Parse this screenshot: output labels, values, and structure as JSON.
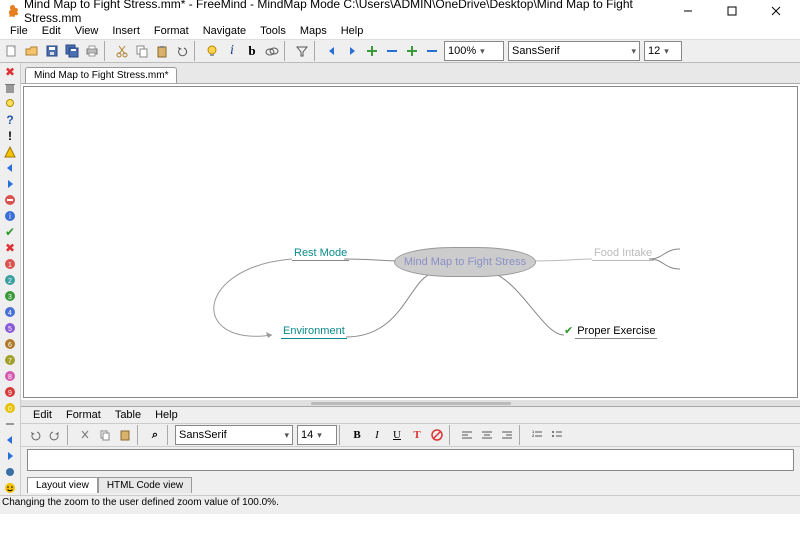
{
  "window": {
    "title": "Mind Map to Fight Stress.mm* - FreeMind - MindMap Mode C:\\Users\\ADMIN\\OneDrive\\Desktop\\Mind Map to Fight Stress.mm"
  },
  "menu": {
    "file": "File",
    "edit": "Edit",
    "view": "View",
    "insert": "Insert",
    "format": "Format",
    "navigate": "Navigate",
    "tools": "Tools",
    "maps": "Maps",
    "help": "Help"
  },
  "toolbar": {
    "zoom": "100%",
    "font": "SansSerif",
    "size": "12"
  },
  "tab": {
    "doc": "Mind Map to Fight Stress.mm*"
  },
  "mindmap": {
    "center": "Mind Map to Fight Stress",
    "left1": "Rest Mode",
    "left2": "Environment",
    "right1": "Food Intake",
    "right2": "Proper Exercise"
  },
  "editor": {
    "menu": {
      "edit": "Edit",
      "format": "Format",
      "table": "Table",
      "help": "Help"
    },
    "font": "SansSerif",
    "size": "14",
    "tabs": {
      "layout": "Layout view",
      "html": "HTML Code view"
    }
  },
  "status": {
    "text": "Changing the zoom to the user defined zoom value of 100.0%."
  },
  "icons": {
    "new": "new-icon",
    "open": "open-icon",
    "save": "save-icon",
    "saveas": "saveas-icon",
    "print": "print-icon",
    "cut": "cut-icon",
    "copy": "copy-icon",
    "paste": "paste-icon",
    "bulb": "bulb-icon",
    "italic": "italic-icon",
    "bold": "bold-icon",
    "cloud": "cloud-icon",
    "filter": "filter-icon",
    "left": "left-arrow",
    "right": "right-arrow",
    "plus": "plus-icon",
    "minus": "minus-icon",
    "plus2": "plus2",
    "minus2": "minus2"
  }
}
